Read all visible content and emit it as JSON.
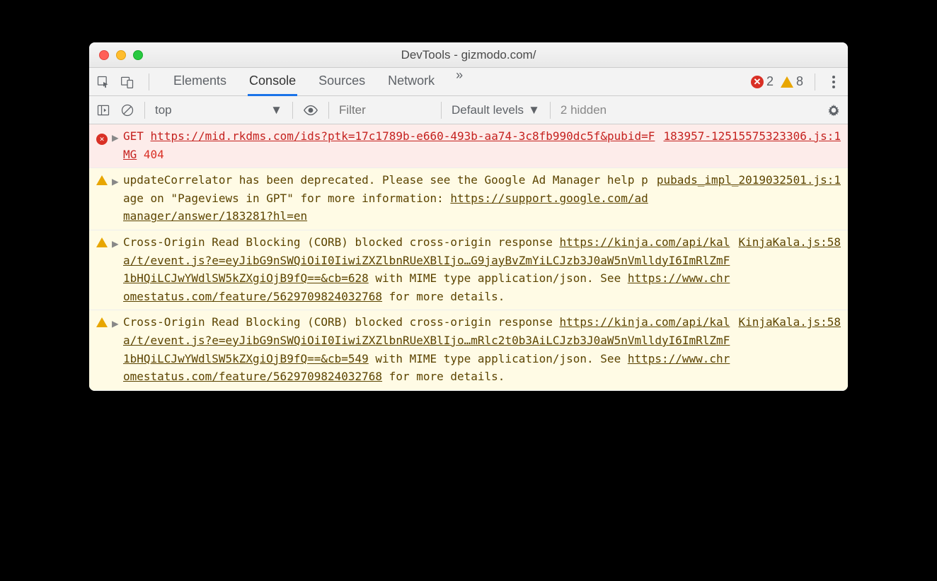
{
  "window": {
    "title": "DevTools - gizmodo.com/"
  },
  "tabs": {
    "items": [
      "Elements",
      "Console",
      "Sources",
      "Network"
    ],
    "active_index": 1,
    "overflow": "»"
  },
  "badges": {
    "error_count": "2",
    "warning_count": "8"
  },
  "toolbar": {
    "context": "top",
    "filter_placeholder": "Filter",
    "levels": "Default levels",
    "hidden": "2 hidden"
  },
  "logs": [
    {
      "type": "error",
      "method": "GET",
      "url": "https://mid.rkdms.com/ids?ptk=17c1789b-e660-493b-aa74-3c8fb990dc5f&pubid=FMG",
      "status": "404",
      "source": "183957-12515575323306.js:1"
    },
    {
      "type": "warning",
      "pre_text": "updateCorrelator has been deprecated. Please see the Google Ad Manager help page on \"Pageviews in GPT\" for more information: ",
      "link": "https://support.google.com/admanager/answer/183281?hl=en",
      "source": "pubads_impl_2019032501.js:1"
    },
    {
      "type": "warning",
      "pre_text": "Cross-Origin Read Blocking (CORB) blocked cross-origin response ",
      "link": "https://kinja.com/api/kala/t/event.js?e=eyJibG9nSWQiOiI0IiwiZXZlbnRUeXBlIjo…G9jayBvZmYiLCJzb3J0aW5nVmlldyI6ImRlZmF1bHQiLCJwYWdlSW5kZXgiOjB9fQ==&cb=628",
      "mid_text": " with MIME type application/json. See ",
      "link2": "https://www.chromestatus.com/feature/5629709824032768",
      "post_text": " for more details.",
      "source": "KinjaKala.js:58"
    },
    {
      "type": "warning",
      "pre_text": "Cross-Origin Read Blocking (CORB) blocked cross-origin response ",
      "link": "https://kinja.com/api/kala/t/event.js?e=eyJibG9nSWQiOiI0IiwiZXZlbnRUeXBlIjo…mRlc2t0b3AiLCJzb3J0aW5nVmlldyI6ImRlZmF1bHQiLCJwYWdlSW5kZXgiOjB9fQ==&cb=549",
      "mid_text": " with MIME type application/json. See ",
      "link2": "https://www.chromestatus.com/feature/5629709824032768",
      "post_text": " for more details.",
      "source": "KinjaKala.js:58"
    }
  ]
}
